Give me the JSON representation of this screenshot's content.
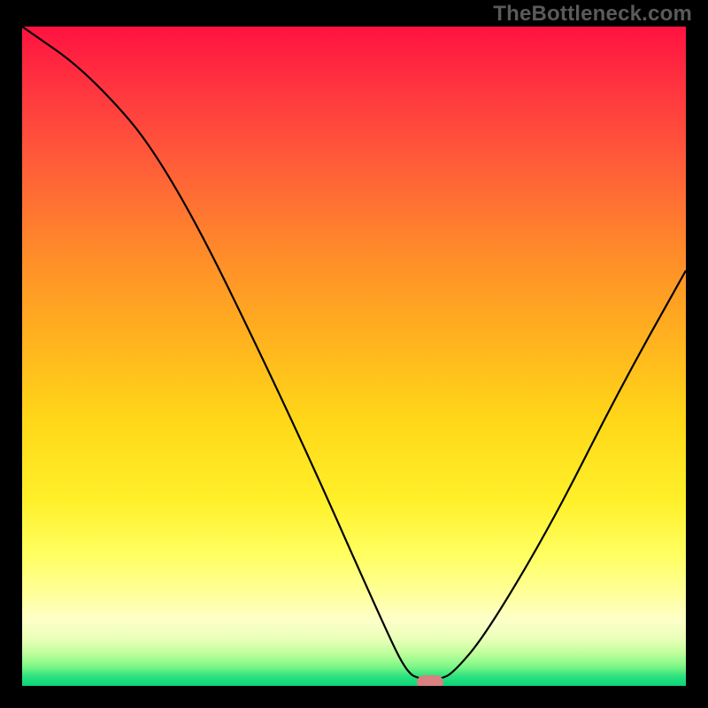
{
  "watermark": "TheBottleneck.com",
  "chart_data": {
    "type": "line",
    "title": "",
    "xlabel": "",
    "ylabel": "",
    "xlim": [
      0,
      100
    ],
    "ylim": [
      0,
      100
    ],
    "series": [
      {
        "name": "bottleneck-curve",
        "x": [
          0,
          10,
          22,
          40,
          55,
          58,
          60,
          63,
          65,
          70,
          80,
          90,
          100
        ],
        "values": [
          100,
          93,
          79,
          42,
          8,
          2,
          1,
          1,
          2,
          8,
          25,
          45,
          63
        ]
      }
    ],
    "marker": {
      "x": 61.5,
      "y": 0.5
    },
    "gradient_stops": [
      {
        "pos": 0,
        "color": "#ff1240"
      },
      {
        "pos": 8,
        "color": "#ff3040"
      },
      {
        "pos": 20,
        "color": "#ff5a3a"
      },
      {
        "pos": 34,
        "color": "#ff8a2a"
      },
      {
        "pos": 48,
        "color": "#ffb41e"
      },
      {
        "pos": 60,
        "color": "#ffd818"
      },
      {
        "pos": 72,
        "color": "#fff02a"
      },
      {
        "pos": 80,
        "color": "#ffff60"
      },
      {
        "pos": 86,
        "color": "#ffff9a"
      },
      {
        "pos": 90,
        "color": "#fdffc8"
      },
      {
        "pos": 93,
        "color": "#e8ffb8"
      },
      {
        "pos": 95,
        "color": "#c0ff9c"
      },
      {
        "pos": 97,
        "color": "#80f788"
      },
      {
        "pos": 98.5,
        "color": "#30e27e"
      },
      {
        "pos": 100,
        "color": "#08d47a"
      }
    ]
  }
}
